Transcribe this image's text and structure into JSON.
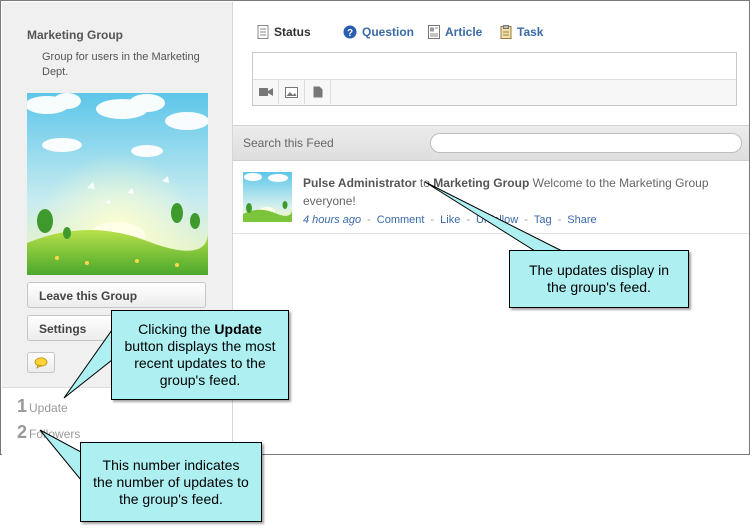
{
  "group": {
    "name": "Marketing Group",
    "description": "Group for users in the Marketing Dept."
  },
  "sidebar": {
    "leave_label": "Leave this Group",
    "settings_label": "Settings",
    "stats": [
      {
        "count": "1",
        "label": "Update"
      },
      {
        "count": "2",
        "label": "Followers"
      }
    ]
  },
  "composer": {
    "tabs": [
      {
        "label": "Status"
      },
      {
        "label": "Question"
      },
      {
        "label": "Article"
      },
      {
        "label": "Task"
      }
    ],
    "tools": [
      "video-icon",
      "image-icon",
      "document-icon"
    ]
  },
  "search": {
    "label": "Search this Feed",
    "value": ""
  },
  "feed": {
    "items": [
      {
        "author": "Pulse Administrator",
        "connector": "to",
        "target": "Marketing Group",
        "message": "Welcome to the Marketing Group everyone!",
        "time": "4 hours ago",
        "actions": [
          "Comment",
          "Like",
          "Unfollow",
          "Tag",
          "Share"
        ]
      }
    ]
  },
  "callouts": {
    "feed": "The updates display in the group's feed.",
    "update_prefix": "Clicking the",
    "update_bold": "Update",
    "update_suffix": "button displays the most recent updates to the group's feed.",
    "count": "This number indicates the number of updates to the group's feed."
  },
  "colors": {
    "callout_bg": "#aef0f2",
    "link": "#3a6aa8",
    "sidebar_bg": "#f0f0f0"
  }
}
